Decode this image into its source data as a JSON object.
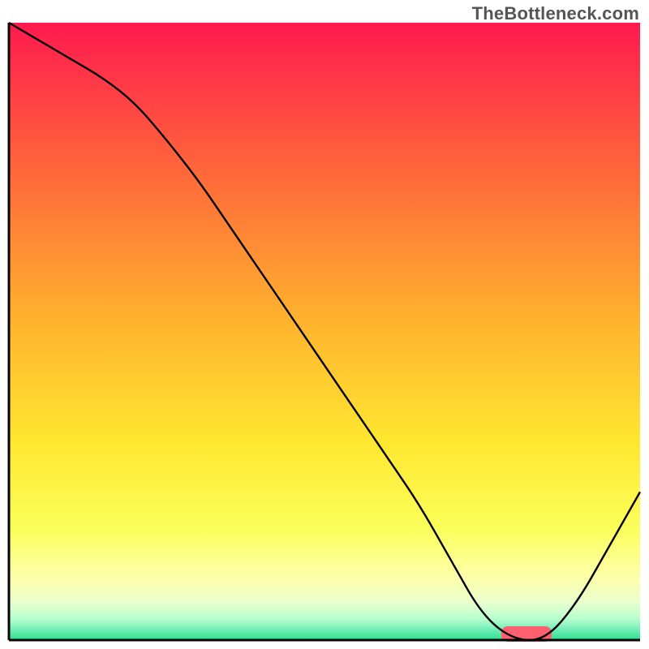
{
  "attribution": "TheBottleneck.com",
  "chart_data": {
    "type": "line",
    "title": "",
    "xlabel": "",
    "ylabel": "",
    "xlim": [
      0,
      100
    ],
    "ylim": [
      0,
      100
    ],
    "x": [
      0,
      5,
      10,
      15,
      20,
      25,
      30,
      35,
      40,
      45,
      50,
      55,
      60,
      65,
      70,
      75,
      80,
      85,
      90,
      95,
      100
    ],
    "values": [
      100,
      97,
      94,
      91,
      87,
      81,
      74.5,
      67,
      59.5,
      52,
      44.5,
      37,
      29.5,
      22,
      13,
      4,
      0,
      0,
      6,
      15,
      24
    ],
    "optimal_range_x": [
      78,
      86
    ],
    "background": {
      "type": "vertical_gradient",
      "stops": [
        {
          "pos": 0.0,
          "color": "#ff1a4f"
        },
        {
          "pos": 0.25,
          "color": "#ff6a3a"
        },
        {
          "pos": 0.48,
          "color": "#ffb22e"
        },
        {
          "pos": 0.68,
          "color": "#ffe730"
        },
        {
          "pos": 0.82,
          "color": "#fbff5a"
        },
        {
          "pos": 0.9,
          "color": "#fdffac"
        },
        {
          "pos": 0.94,
          "color": "#e8ffce"
        },
        {
          "pos": 0.965,
          "color": "#b8ffce"
        },
        {
          "pos": 0.98,
          "color": "#7ff0bc"
        },
        {
          "pos": 1.0,
          "color": "#29e08f"
        }
      ]
    },
    "marker": {
      "x": 82,
      "y": 0,
      "width": 8,
      "height": 2.5,
      "color": "#ff5f6f"
    },
    "curve_color": "#000000",
    "axis_color": "#000000"
  }
}
